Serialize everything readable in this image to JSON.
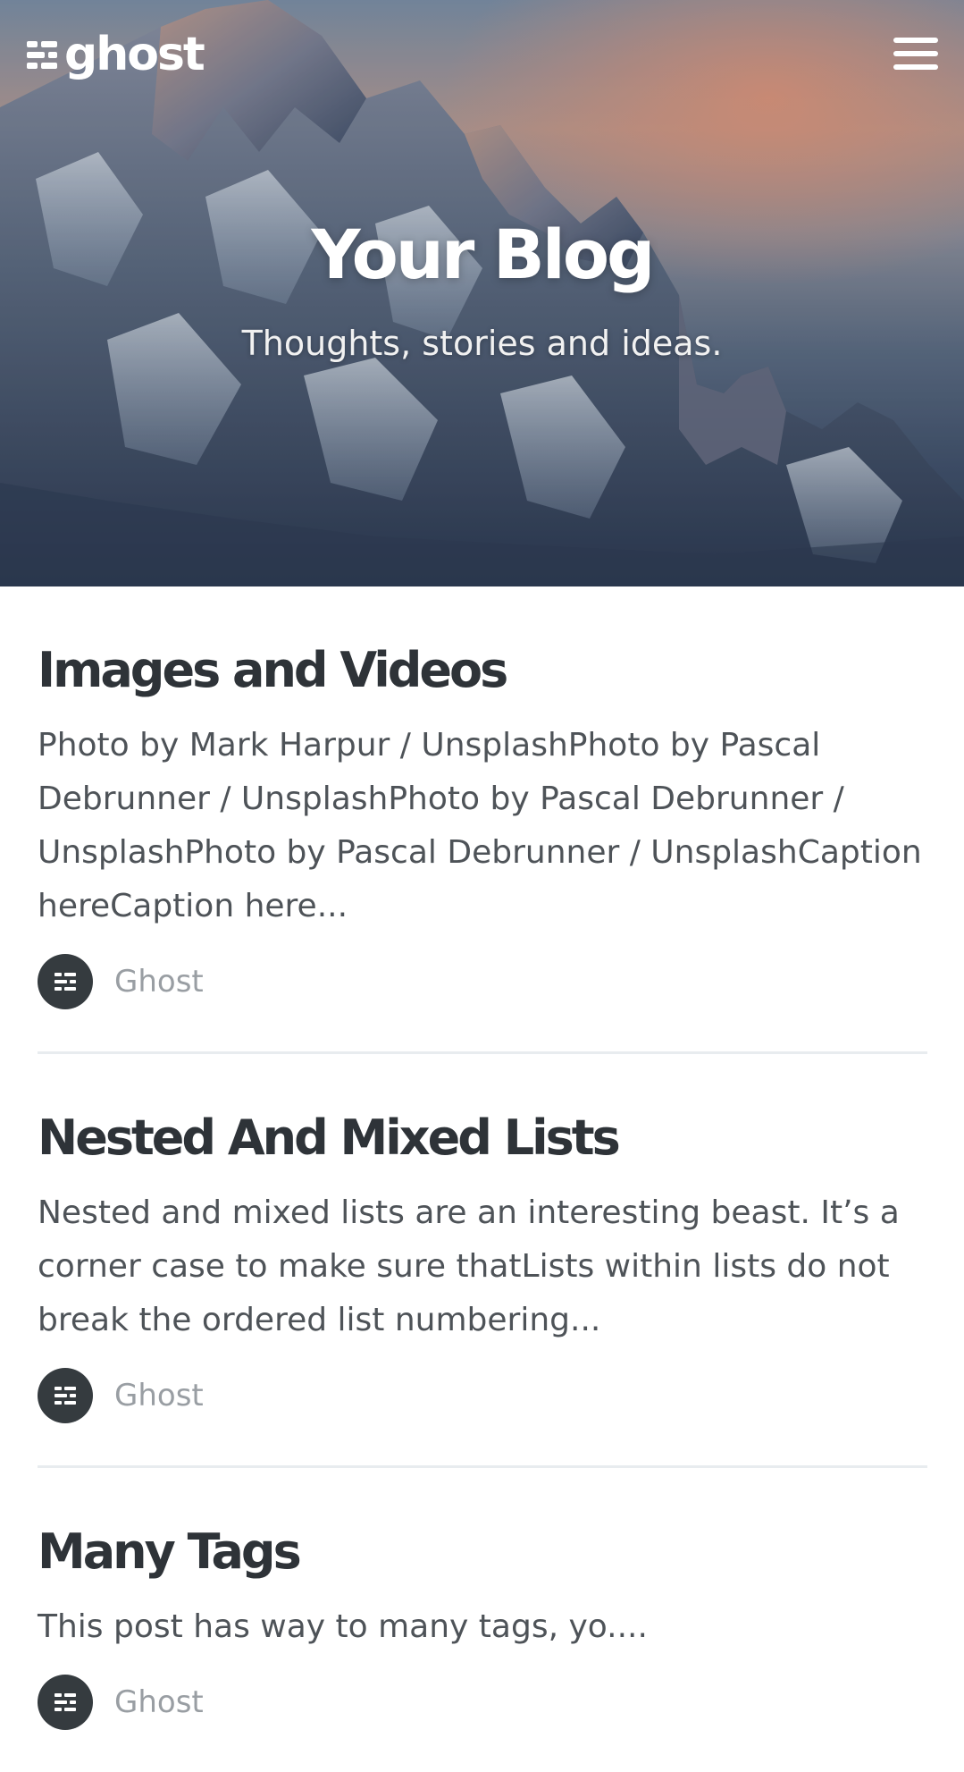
{
  "site": {
    "logo_text": "ghost",
    "title": "Your Blog",
    "description": "Thoughts, stories and ideas."
  },
  "posts": [
    {
      "title": "Images and Videos",
      "excerpt": "Photo by Mark Harpur / UnsplashPhoto by Pascal Debrunner / UnsplashPhoto by Pascal Debrunner / UnsplashPhoto by Pascal Debrunner / UnsplashCaption hereCaption here...",
      "author": "Ghost"
    },
    {
      "title": "Nested And Mixed Lists",
      "excerpt": "Nested and mixed lists are an interesting beast. It’s a corner case to make sure thatLists within lists do not break the ordered list numbering...",
      "author": "Ghost"
    },
    {
      "title": "Many Tags",
      "excerpt": "This post has way to many tags, yo....",
      "author": "Ghost"
    }
  ],
  "colors": {
    "avatar_bg": "#353b3f",
    "title_text": "#2e3338",
    "excerpt_text": "#4e5358",
    "meta_text": "#999ea3"
  },
  "icons": {
    "logo": "ghost-logo-icon",
    "menu": "hamburger-menu-icon",
    "avatar": "ghost-avatar-icon"
  }
}
